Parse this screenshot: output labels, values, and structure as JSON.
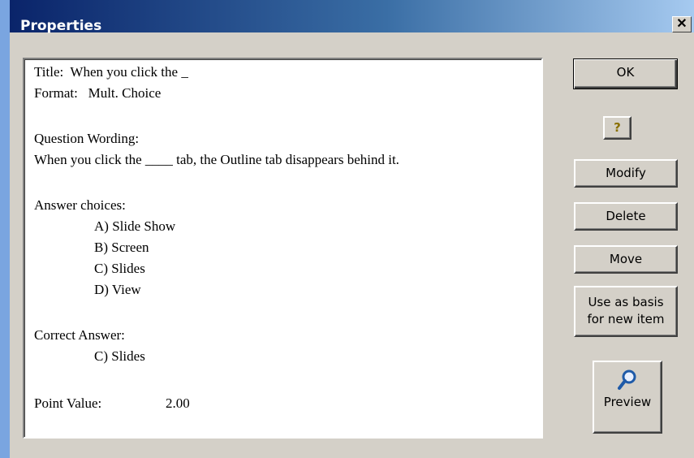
{
  "window": {
    "title": "Properties",
    "close_glyph": "✕"
  },
  "content": {
    "title_line": "Title:  When you click the _",
    "format_line": "Format:   Mult. Choice",
    "question_heading": "Question Wording:",
    "question_text": "When you click the ____ tab, the Outline tab disappears behind it.",
    "answers_heading": "Answer choices:",
    "answers": [
      "A) Slide Show",
      "B) Screen",
      "C) Slides",
      "D) View"
    ],
    "correct_heading": "Correct Answer:",
    "correct_answer": "C) Slides",
    "point_label": "Point Value:",
    "point_value": "2.00"
  },
  "buttons": {
    "ok": "OK",
    "help": "?",
    "modify": "Modify",
    "delete": "Delete",
    "move": "Move",
    "basis_line1": "Use as basis",
    "basis_line2": "for new item",
    "preview": "Preview"
  },
  "icons": {
    "help": "question-mark-icon",
    "preview": "magnifier-icon",
    "close": "close-icon"
  },
  "colors": {
    "titlebar_start": "#0a246a",
    "titlebar_end": "#a6caf0",
    "dialog_bg": "#d4d0c8",
    "help_icon": "#8a7000",
    "magnifier": "#1e5aa8"
  }
}
